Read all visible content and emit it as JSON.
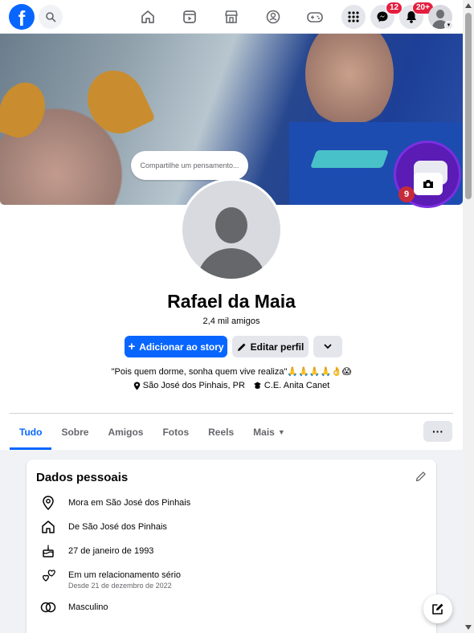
{
  "header": {
    "logo": "f",
    "messenger_badge": "12",
    "notifications_badge": "20+"
  },
  "cover": {
    "thought_placeholder": "Compartilhe um pensamento...",
    "story_count": "9"
  },
  "profile": {
    "name": "Rafael da Maia",
    "friends": "2,4 mil amigos",
    "add_story_label": "Adicionar ao story",
    "edit_profile_label": "Editar perfil",
    "bio": "\"Pois quem dorme, sonha quem vive realiza\"🙏🙏🙏🙏👌😱",
    "location": "São José dos Pinhais, PR",
    "school": "C.E. Anita Canet"
  },
  "tabs": [
    "Tudo",
    "Sobre",
    "Amigos",
    "Fotos",
    "Reels",
    "Mais"
  ],
  "personal": {
    "title": "Dados pessoais",
    "lives_in": "Mora em São José dos Pinhais",
    "from": "De São José dos Pinhais",
    "birthday": "27 de janeiro de 1993",
    "relationship": "Em um relacionamento sério",
    "relationship_since": "Desde 21 de dezembro de 2022",
    "gender": "Masculino"
  },
  "colors": {
    "brand": "#0866ff",
    "badge": "#e41e3f"
  }
}
